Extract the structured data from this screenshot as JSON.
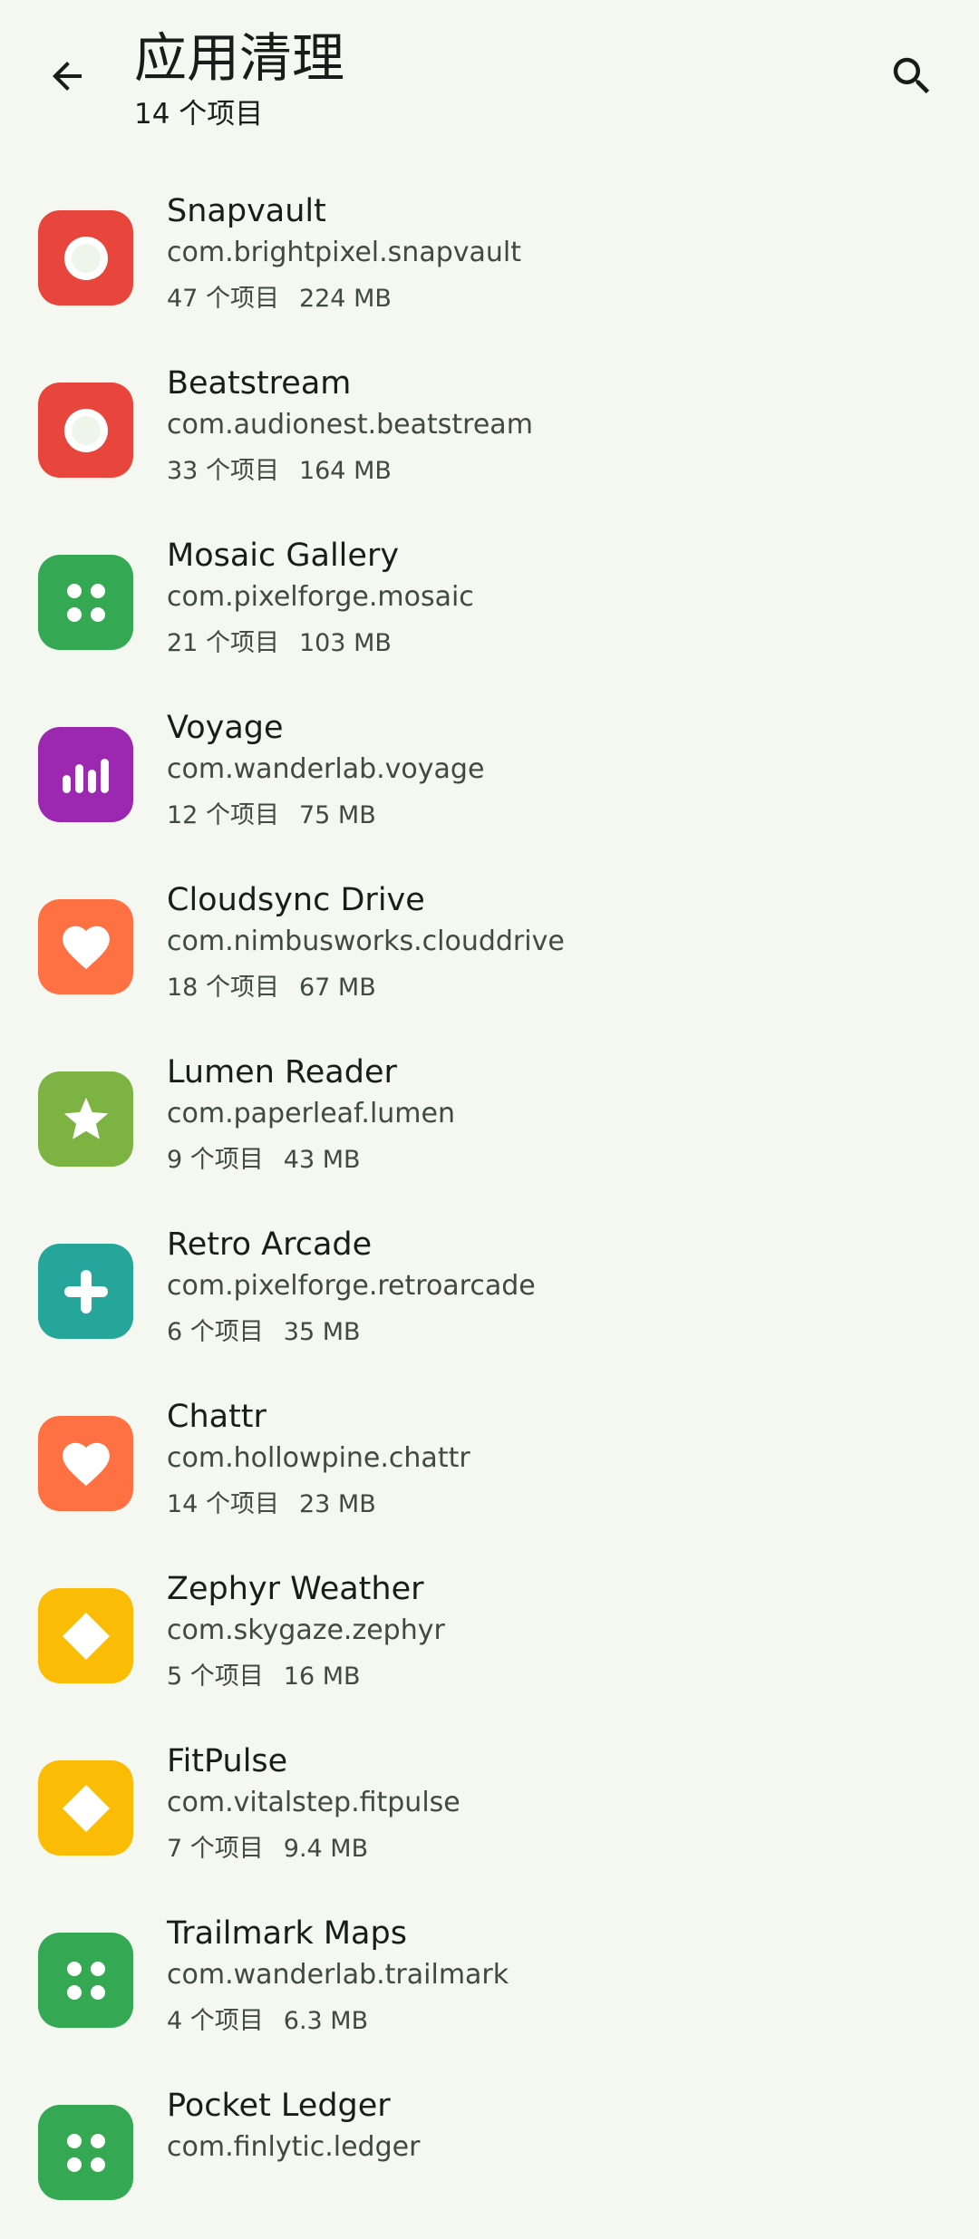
{
  "header": {
    "title": "应用清理",
    "subtitle": "14 个项目"
  },
  "icons": {
    "back": "arrow-back-icon",
    "search": "search-icon"
  },
  "apps": [
    {
      "name": "Snapvault",
      "package": "com.brightpixel.snapvault",
      "items": "47 个项目",
      "size": "224 MB",
      "icon": "circle",
      "color": "#e8453c"
    },
    {
      "name": "Beatstream",
      "package": "com.audionest.beatstream",
      "items": "33 个项目",
      "size": "164 MB",
      "icon": "circle",
      "color": "#e8453c"
    },
    {
      "name": "Mosaic Gallery",
      "package": "com.pixelforge.mosaic",
      "items": "21 个项目",
      "size": "103 MB",
      "icon": "dots",
      "color": "#34a853"
    },
    {
      "name": "Voyage",
      "package": "com.wanderlab.voyage",
      "items": "12 个项目",
      "size": "75 MB",
      "icon": "bars",
      "color": "#9c27b0"
    },
    {
      "name": "Cloudsync Drive",
      "package": "com.nimbusworks.clouddrive",
      "items": "18 个项目",
      "size": "67 MB",
      "icon": "heart",
      "color": "#ff7043"
    },
    {
      "name": "Lumen Reader",
      "package": "com.paperleaf.lumen",
      "items": "9 个项目",
      "size": "43 MB",
      "icon": "star",
      "color": "#7cb342"
    },
    {
      "name": "Retro Arcade",
      "package": "com.pixelforge.retroarcade",
      "items": "6 个项目",
      "size": "35 MB",
      "icon": "plus",
      "color": "#26a69a"
    },
    {
      "name": "Chattr",
      "package": "com.hollowpine.chattr",
      "items": "14 个项目",
      "size": "23 MB",
      "icon": "heart",
      "color": "#ff7043"
    },
    {
      "name": "Zephyr Weather",
      "package": "com.skygaze.zephyr",
      "items": "5 个项目",
      "size": "16 MB",
      "icon": "diamond",
      "color": "#fbbc05"
    },
    {
      "name": "FitPulse",
      "package": "com.vitalstep.fitpulse",
      "items": "7 个项目",
      "size": "9.4 MB",
      "icon": "diamond",
      "color": "#fbbc05"
    },
    {
      "name": "Trailmark Maps",
      "package": "com.wanderlab.trailmark",
      "items": "4 个项目",
      "size": "6.3 MB",
      "icon": "dots",
      "color": "#34a853"
    },
    {
      "name": "Pocket Ledger",
      "package": "com.finlytic.ledger",
      "items": "",
      "size": "",
      "icon": "dots",
      "color": "#34a853"
    }
  ]
}
